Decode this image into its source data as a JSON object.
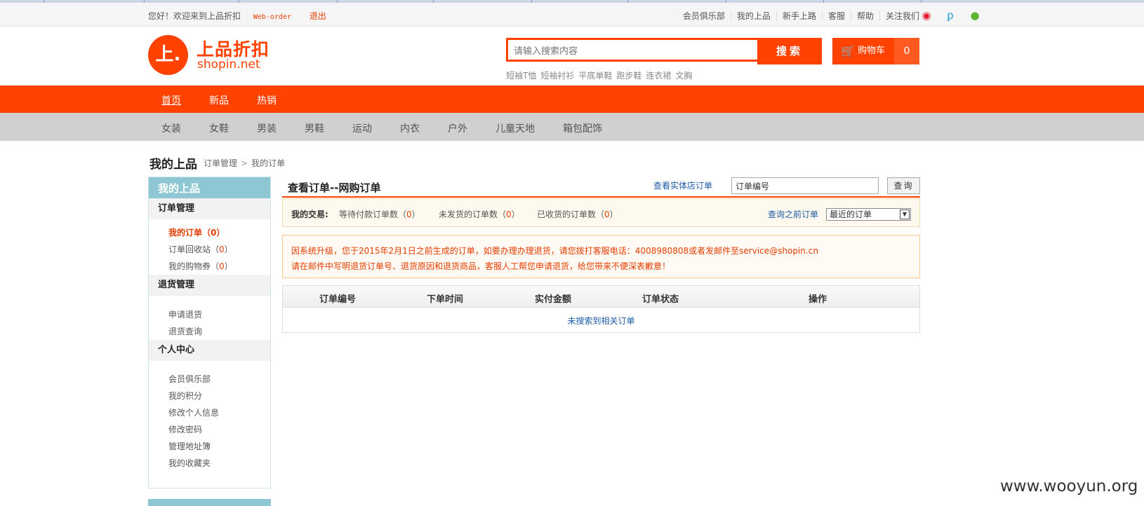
{
  "topbar": {
    "greeting": "您好！欢迎来到上品折扣",
    "weborder": "Web-order",
    "logout": "退出",
    "links": [
      "会员俱乐部",
      "我的上品",
      "新手上路",
      "客服",
      "帮助",
      "关注我们"
    ],
    "social_icons": [
      "weibo-icon",
      "tencent-weibo-icon",
      "wechat-icon"
    ]
  },
  "header": {
    "logo_mark": "上.",
    "logo_text": "上品折扣",
    "logo_sub": "shopin.net",
    "search_placeholder": "请输入搜索内容",
    "search_button": "搜索",
    "cart_label": "购物车",
    "cart_count": "0",
    "hot_terms": [
      "短袖T恤",
      "短袖衬衫",
      "平底单鞋",
      "跑步鞋",
      "连衣裙",
      "文胸"
    ]
  },
  "nav_main": [
    "首页",
    "新品",
    "热销"
  ],
  "nav_sub": [
    "女装",
    "女鞋",
    "男装",
    "男鞋",
    "运动",
    "内衣",
    "户外",
    "儿童天地",
    "箱包配饰"
  ],
  "breadcrumb": {
    "title": "我的上品",
    "items": [
      "订单管理",
      "我的订单"
    ],
    "separator": ">"
  },
  "sidebar": {
    "head": "我的上品",
    "groups": [
      {
        "title": "订单管理",
        "items": [
          {
            "label": "我的订单",
            "count": "0"
          },
          {
            "label": "订单回收站",
            "count": "0"
          },
          {
            "label": "我的购物券",
            "count": "0"
          }
        ]
      },
      {
        "title": "退货管理",
        "items": [
          {
            "label": "申请退货"
          },
          {
            "label": "退货查询"
          }
        ]
      },
      {
        "title": "个人中心",
        "items": [
          {
            "label": "会员俱乐部"
          },
          {
            "label": "我的积分"
          },
          {
            "label": "修改个人信息"
          },
          {
            "label": "修改密码"
          },
          {
            "label": "管理地址簿"
          },
          {
            "label": "我的收藏夹"
          }
        ]
      }
    ]
  },
  "main": {
    "title": "查看订单--网购订单",
    "store_link": "查看实体店订单",
    "order_no_value": "订单编号",
    "query_button": "查询",
    "trades_label": "我的交易:",
    "stats": [
      {
        "label": "等待付款订单数",
        "count": "0"
      },
      {
        "label": "未发货的订单数",
        "count": "0"
      },
      {
        "label": "已收货的订单数",
        "count": "0"
      }
    ],
    "prev_link": "查询之前订单",
    "range_selected": "最近的订单",
    "notice_line1": "因系统升级，您于2015年2月1日之前生成的订单，如要办理办理退货，请您拨打客服电话：4008980808或者发邮件至service@shopin.cn",
    "notice_line2": "请在邮件中写明退货订单号、退货原因和退货商品，客服人工帮您申请退货，给您带来不便深表歉意！",
    "table_headers": [
      "订单编号",
      "下单时间",
      "实付金额",
      "订单状态",
      "操作"
    ],
    "empty_text": "未搜索到相关订单"
  },
  "watermark": "www.wooyun.org",
  "colors": {
    "brand": "#ff4200",
    "link": "#1e5da8",
    "sidebar_head": "#8ec6d4"
  }
}
